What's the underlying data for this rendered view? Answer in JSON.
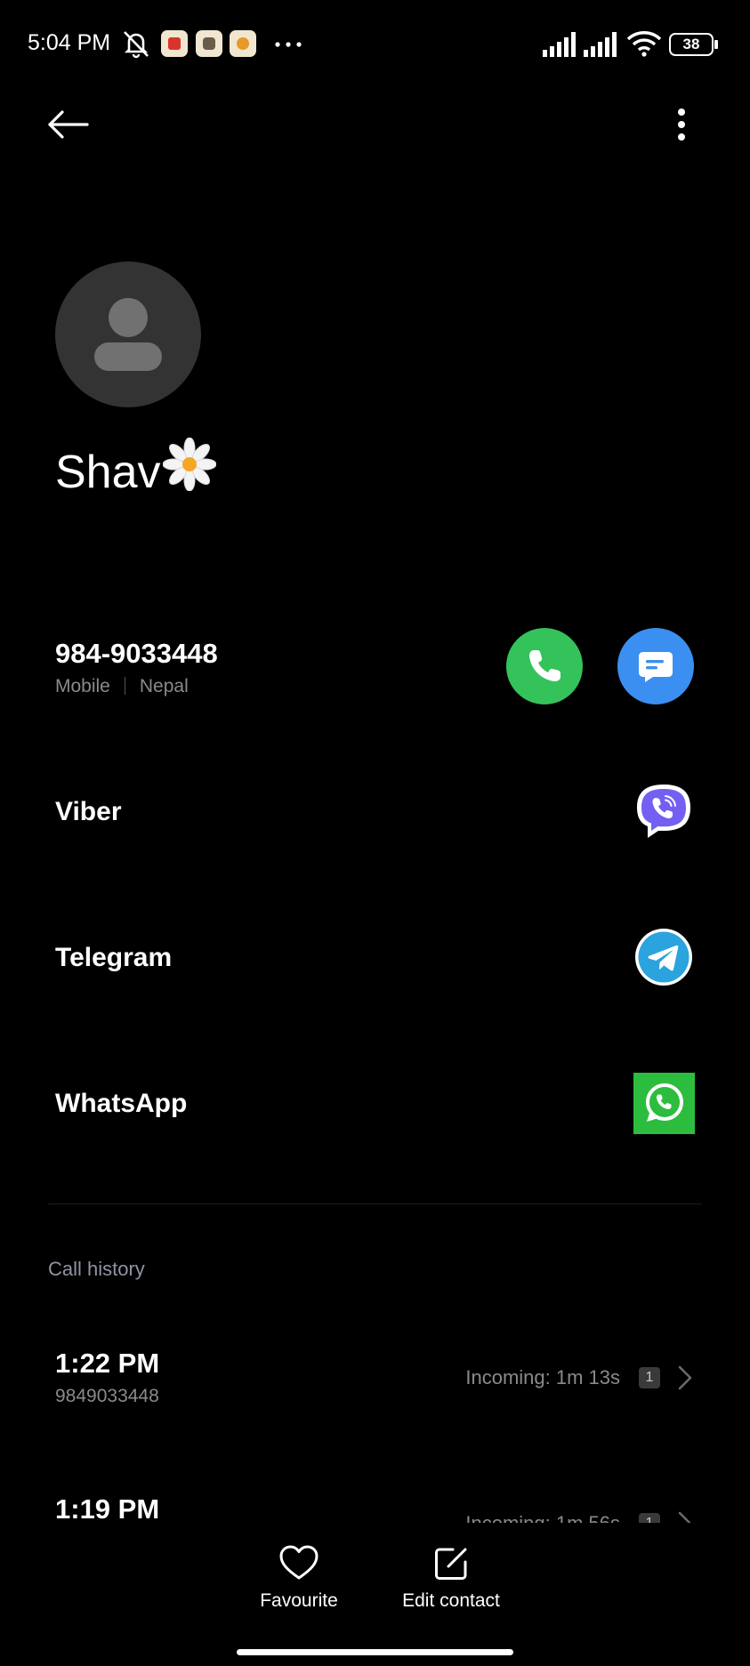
{
  "status_bar": {
    "time": "5:04 PM",
    "battery": "38",
    "icons": [
      "silent-icon",
      "notification-app-icon",
      "notification-app-icon",
      "notification-app-icon",
      "more-notifications-icon",
      "signal-icon",
      "signal-icon",
      "wifi-icon",
      "battery-icon"
    ]
  },
  "toolbar": {
    "back_icon": "arrow-left-icon",
    "menu_icon": "more-vertical-icon"
  },
  "contact": {
    "name": "Shav",
    "name_emoji": "daisy-flower-icon"
  },
  "phone": {
    "number": "984-9033448",
    "type": "Mobile",
    "region": "Nepal",
    "call_color": "#34c35a",
    "message_color": "#3b8ff0"
  },
  "apps": [
    {
      "label": "Viber",
      "icon": "viber-icon",
      "color": "#7360f2"
    },
    {
      "label": "Telegram",
      "icon": "telegram-icon",
      "color": "#2aa3de"
    },
    {
      "label": "WhatsApp",
      "icon": "whatsapp-icon",
      "color": "#2dbd3e"
    }
  ],
  "call_history": {
    "title": "Call history",
    "entries": [
      {
        "time": "1:22 PM",
        "number": "9849033448",
        "detail": "Incoming: 1m 13s",
        "count": "1"
      },
      {
        "time": "1:19 PM",
        "number": "",
        "detail": "Incoming: 1m 56s",
        "count": "1"
      }
    ]
  },
  "bottom_bar": {
    "favourite_label": "Favourite",
    "edit_label": "Edit contact"
  }
}
